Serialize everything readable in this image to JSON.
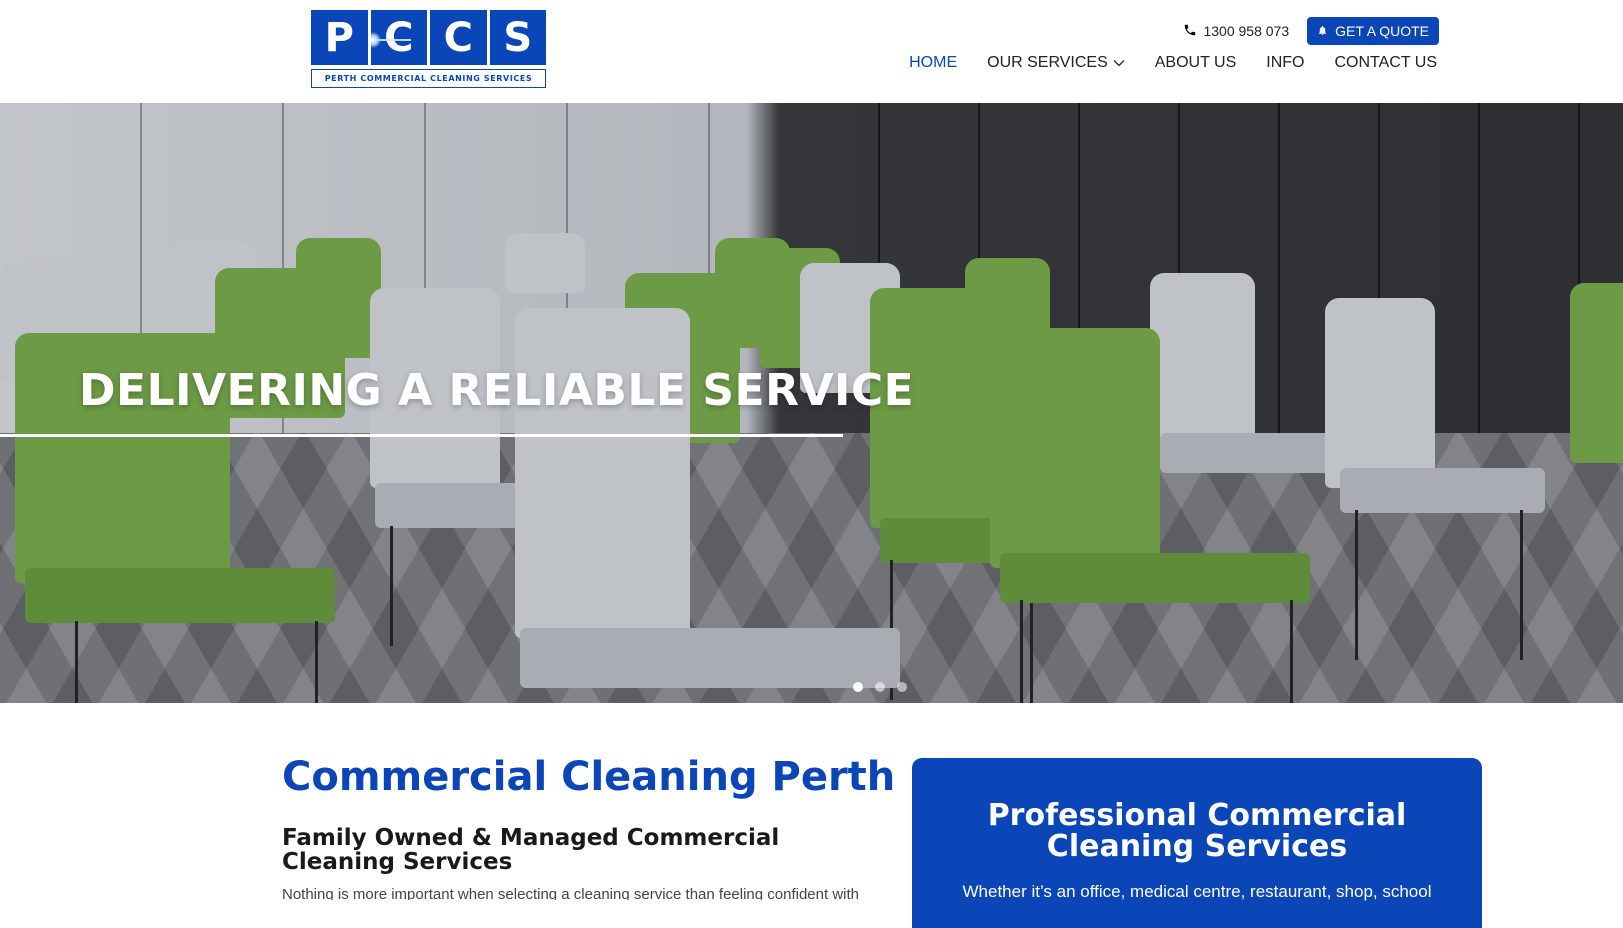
{
  "logo": {
    "letters": [
      "P",
      "C",
      "C",
      "S"
    ],
    "tagline": "PERTH COMMERCIAL CLEANING SERVICES"
  },
  "header": {
    "phone": "1300 958 073",
    "quote_button": "GET A QUOTE",
    "nav": [
      {
        "label": "HOME",
        "active": true
      },
      {
        "label": "OUR SERVICES",
        "dropdown": true
      },
      {
        "label": "ABOUT US"
      },
      {
        "label": "INFO"
      },
      {
        "label": "CONTACT US"
      }
    ]
  },
  "hero": {
    "title": "DELIVERING A RELIABLE SERVICE",
    "slides": 3,
    "active_slide": 1
  },
  "main": {
    "heading": "Commercial Cleaning Perth",
    "subheading": "Family Owned & Managed Commercial Cleaning Services",
    "intro_snippet": "Nothing is more important when selecting a cleaning service than feeling confident with"
  },
  "promo": {
    "title": "Professional Commercial Cleaning Services",
    "text": "Whether it’s an office, medical centre, restaurant, shop, school"
  },
  "colors": {
    "brand_blue": "#0a46b8",
    "nav_text": "#222222",
    "hero_text": "#ffffff"
  },
  "icons": {
    "phone": "phone-icon",
    "quote": "bell-icon",
    "dropdown": "chevron-down-icon"
  }
}
